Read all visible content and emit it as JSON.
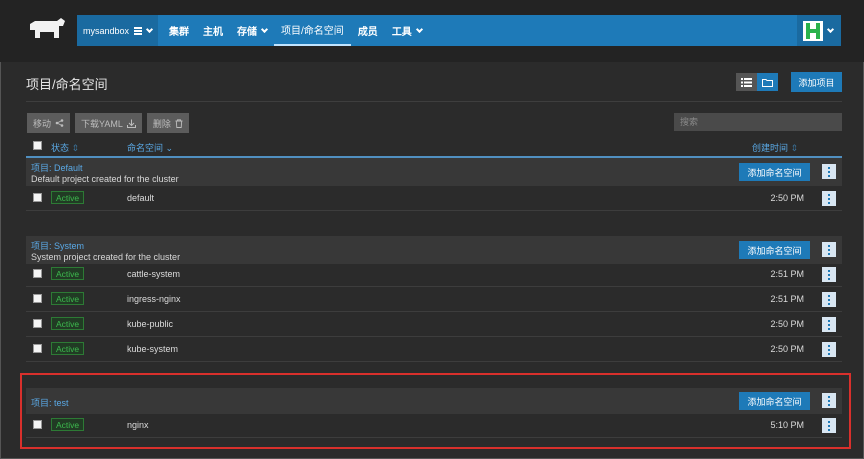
{
  "nav": {
    "cluster": "mysandbox",
    "items": [
      {
        "label": "集群",
        "dropdown": false
      },
      {
        "label": "主机",
        "dropdown": false
      },
      {
        "label": "存储",
        "dropdown": true
      },
      {
        "label": "项目/命名空间",
        "dropdown": false,
        "active": true
      },
      {
        "label": "成员",
        "dropdown": false
      },
      {
        "label": "工具",
        "dropdown": true
      }
    ]
  },
  "page": {
    "title": "项目/命名空间",
    "add_project": "添加项目"
  },
  "toolbar": {
    "move": "移动",
    "download_yaml": "下载YAML",
    "delete": "删除",
    "search_placeholder": "搜索"
  },
  "table": {
    "col_state": "状态",
    "col_namespace": "命名空间",
    "col_created": "创建时间"
  },
  "groups": [
    {
      "name": "项目: Default",
      "description": "Default project created for the cluster",
      "add_label": "添加命名空间",
      "rows": [
        {
          "state": "Active",
          "namespace": "default",
          "time": "2:50 PM"
        }
      ]
    },
    {
      "name": "项目: System",
      "description": "System project created for the cluster",
      "add_label": "添加命名空间",
      "rows": [
        {
          "state": "Active",
          "namespace": "cattle-system",
          "time": "2:51 PM"
        },
        {
          "state": "Active",
          "namespace": "ingress-nginx",
          "time": "2:51 PM"
        },
        {
          "state": "Active",
          "namespace": "kube-public",
          "time": "2:50 PM"
        },
        {
          "state": "Active",
          "namespace": "kube-system",
          "time": "2:50 PM"
        }
      ]
    },
    {
      "name": "项目: test",
      "description": "",
      "add_label": "添加命名空间",
      "rows": [
        {
          "state": "Active",
          "namespace": "nginx",
          "time": "5:10 PM"
        }
      ]
    }
  ],
  "colors": {
    "accent": "#1e7ab8",
    "active_green": "#3dbb4e",
    "highlight_red": "#d9302c"
  }
}
